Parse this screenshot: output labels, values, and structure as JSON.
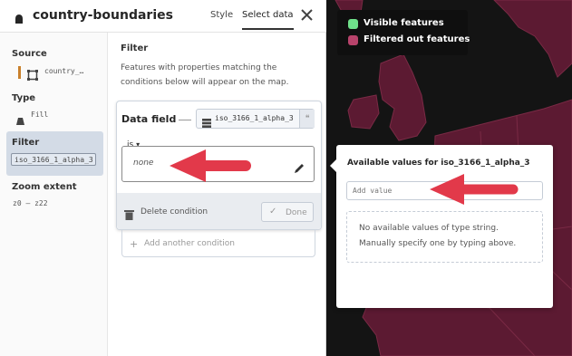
{
  "layer": {
    "title": "country-boundaries"
  },
  "tabs": [
    "Style",
    "Select data"
  ],
  "sidebar": {
    "source_label": "Source",
    "source_value": "country_…",
    "type_label": "Type",
    "type_value": "Fill",
    "filter_label": "Filter",
    "filter_value": "iso_3166_1_alpha_3",
    "zoom_label": "Zoom extent",
    "zoom_value": "z0 – z22"
  },
  "filter": {
    "heading": "Filter",
    "description": "Features with properties matching the conditions below will appear on the map.",
    "data_field_label": "Data field",
    "data_field_value": "iso_3166_1_alpha_3",
    "operator": "is",
    "value_placeholder": "none",
    "delete_label": "Delete condition",
    "done_label": "Done",
    "add_label": "Add another condition"
  },
  "popover": {
    "title": "Available values for iso_3166_1_alpha_3",
    "input_placeholder": "Add value",
    "empty_line1": "No available values of type string.",
    "empty_line2": "Manually specify one by typing above."
  },
  "legend": {
    "items": [
      {
        "label": "Visible features",
        "color": "#6fe08a"
      },
      {
        "label": "Filtered out features",
        "color": "#b8436b"
      }
    ]
  },
  "colors": {
    "accent": "#e2394a",
    "land": "#5c1a32",
    "border": "#7a2a45",
    "selected": "#d3dbe6"
  }
}
